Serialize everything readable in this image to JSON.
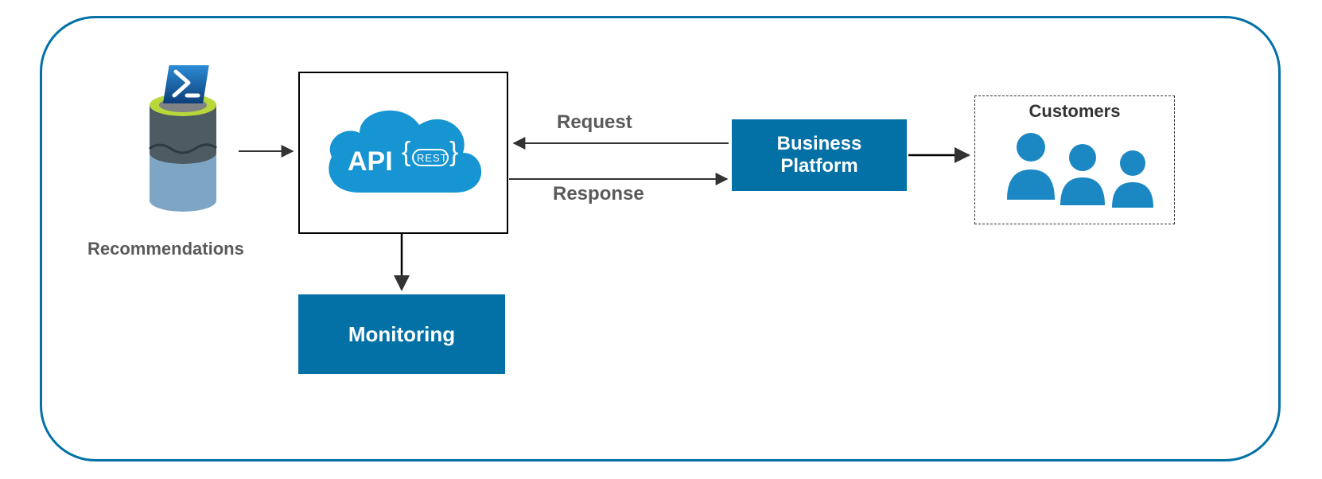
{
  "nodes": {
    "recommendations": {
      "label": "Recommendations"
    },
    "api": {
      "label_main": "API",
      "label_tag": "REST"
    },
    "monitoring": {
      "label": "Monitoring"
    },
    "business_platform": {
      "line1": "Business",
      "line2": "Platform"
    },
    "customers": {
      "label": "Customers"
    }
  },
  "edges": {
    "request": "Request",
    "response": "Response"
  },
  "colors": {
    "brand": "#0471a6",
    "cloud": "#1794d2",
    "text_muted": "#5a5a5a"
  }
}
